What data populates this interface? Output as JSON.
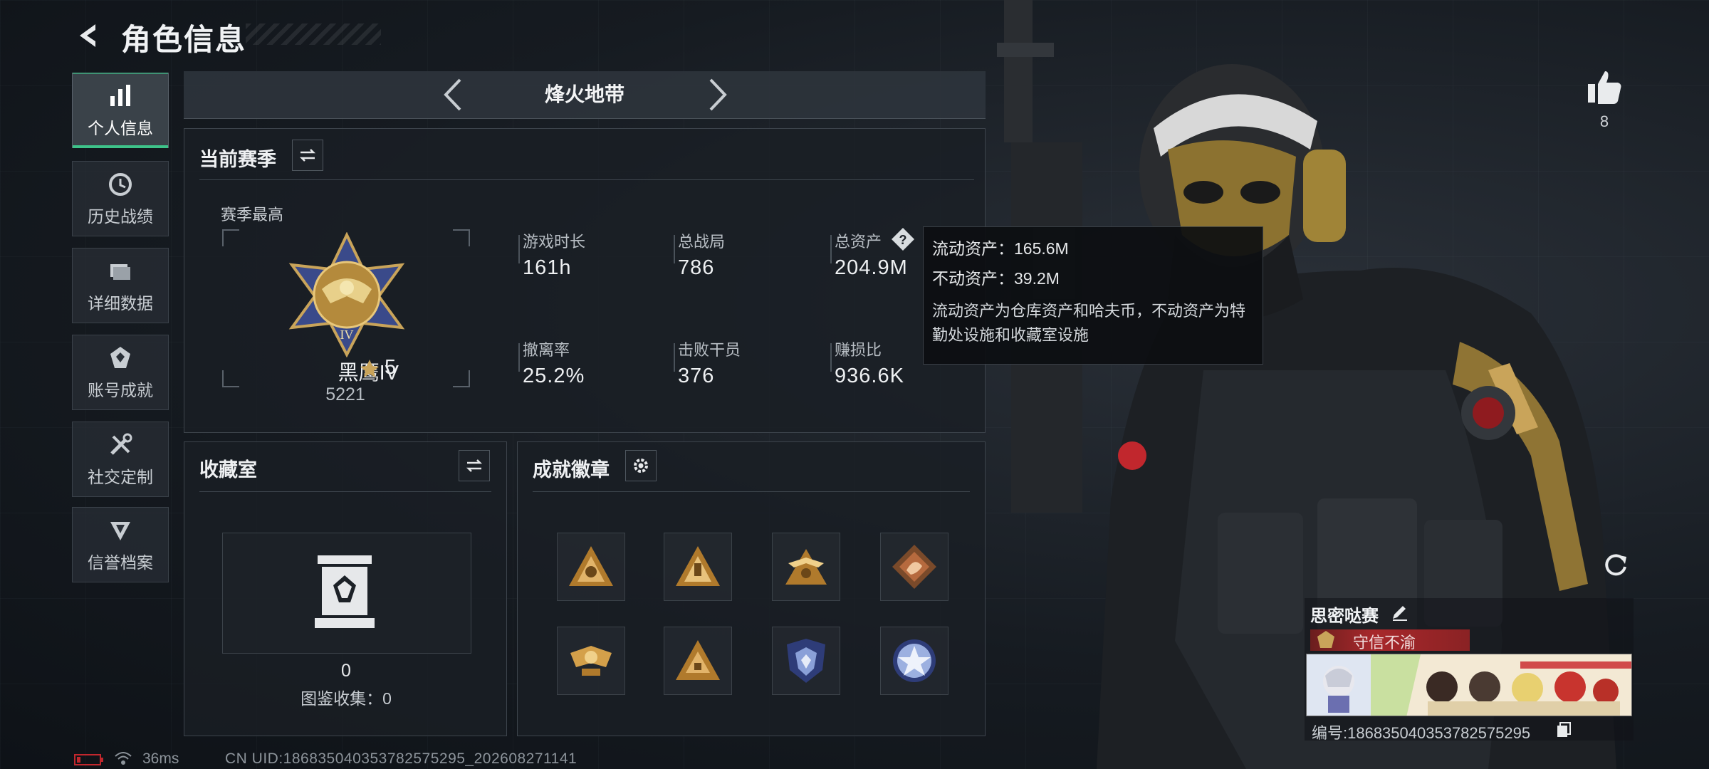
{
  "header": {
    "title": "角色信息"
  },
  "sidebar": {
    "items": [
      {
        "label": "个人信息",
        "active": true
      },
      {
        "label": "历史战绩"
      },
      {
        "label": "详细数据"
      },
      {
        "label": "账号成就"
      },
      {
        "label": "社交定制"
      },
      {
        "label": "信誉档案"
      }
    ]
  },
  "mode": {
    "title": "烽火地带"
  },
  "season": {
    "title": "当前赛季",
    "best_label": "赛季最高",
    "rank_name": "黑鹰IV",
    "rank_stars": "5",
    "rank_score": "5221",
    "stats": [
      {
        "label": "游戏时长",
        "value": "161h"
      },
      {
        "label": "总战局",
        "value": "786"
      },
      {
        "label": "总资产",
        "value": "204.9M"
      },
      {
        "label": "撤离率",
        "value": "25.2%"
      },
      {
        "label": "击败干员",
        "value": "376"
      },
      {
        "label": "赚损比",
        "value": "936.6K"
      }
    ]
  },
  "tooltip": {
    "liquid": "流动资产：165.6M",
    "fixed": "不动资产：39.2M",
    "desc": "流动资产为仓库资产和哈夫币，不动资产为特勤处设施和收藏室设施"
  },
  "collection": {
    "title": "收藏室",
    "count": "0",
    "catalog_label": "图鉴收集：0"
  },
  "achievements": {
    "title": "成就徽章",
    "badges": [
      "badge-1",
      "badge-2",
      "badge-3",
      "badge-4",
      "badge-5",
      "badge-6",
      "badge-7",
      "badge-8"
    ]
  },
  "profile": {
    "likes": "8",
    "name": "思密哒赛",
    "honor": "守信不渝",
    "id_text": "编号:18683504035378257529​5"
  },
  "footer": {
    "ping": "36ms",
    "uid": "CN UID:18683504035378257529​5_202608271141"
  },
  "colors": {
    "accent_green": "#3ec38a",
    "honor_red": "#a8282b",
    "gold": "#c9a45a"
  }
}
